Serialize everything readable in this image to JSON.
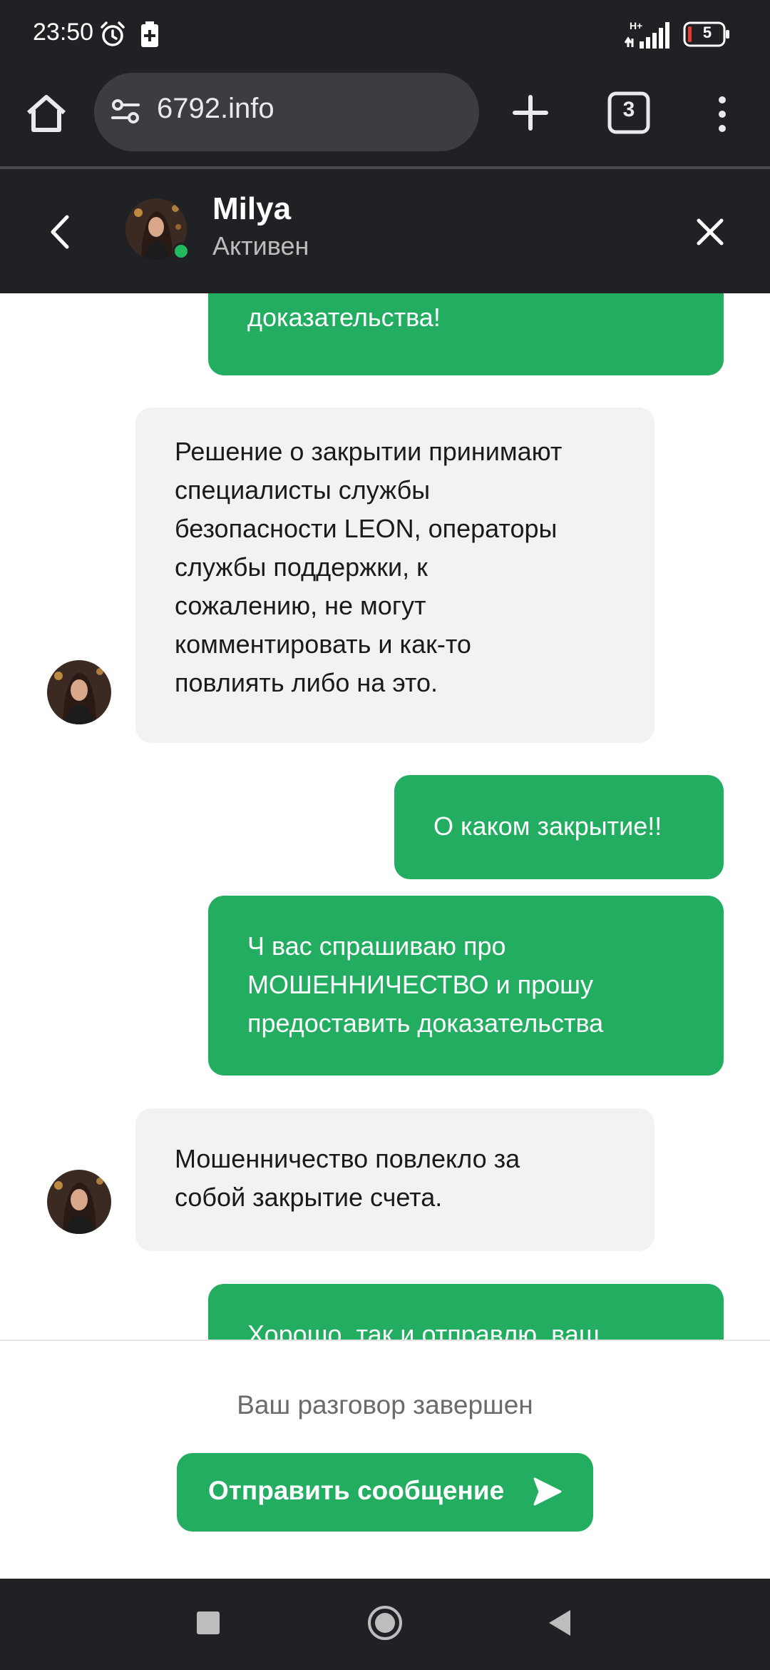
{
  "status_bar": {
    "time": "23:50",
    "network": "H+",
    "battery_level": "5"
  },
  "browser": {
    "url": "6792.info",
    "tab_count": "3"
  },
  "chat_header": {
    "agent_name": "Milya",
    "agent_status": "Активен"
  },
  "messages": [
    {
      "direction": "outgoing",
      "lines": [
        "доказательства!"
      ]
    },
    {
      "direction": "incoming",
      "lines": [
        "Решение о закрытии принимают",
        "специалисты службы",
        "безопасности LEON, операторы",
        "службы поддержки, к",
        "сожалению, не могут",
        "комментировать и как-то",
        "повлиять либо на это."
      ]
    },
    {
      "direction": "outgoing",
      "lines": [
        "О каком закрытие!!"
      ]
    },
    {
      "direction": "outgoing",
      "lines": [
        "Ч вас спрашиваю про",
        "МОШЕННИЧЕСТВО и прошу",
        "предоставить доказательства"
      ]
    },
    {
      "direction": "incoming",
      "lines": [
        "Мошенничество повлекло за",
        "собой закрытие счета."
      ]
    },
    {
      "direction": "outgoing",
      "lines": [
        "Хорошо, так и отправлю, ваш"
      ]
    }
  ],
  "footer": {
    "ended_text": "Ваш разговор завершен",
    "send_button_label": "Отправить сообщение"
  },
  "colors": {
    "accent_green": "#22ad61",
    "dark_bar": "#202124",
    "incoming_bubble": "#f2f2f2",
    "online_dot": "#22b95f"
  },
  "icons": {
    "status": [
      "alarm-icon",
      "battery-saver-icon",
      "signal-icon",
      "battery-icon"
    ],
    "toolbar": [
      "home-icon",
      "site-settings-icon",
      "plus-icon",
      "tabs-icon",
      "more-vert-icon"
    ],
    "header": [
      "back-arrow-icon",
      "close-icon"
    ],
    "footer": [
      "send-icon"
    ],
    "nav": [
      "recents-icon",
      "home-circle-icon",
      "back-triangle-icon"
    ]
  }
}
